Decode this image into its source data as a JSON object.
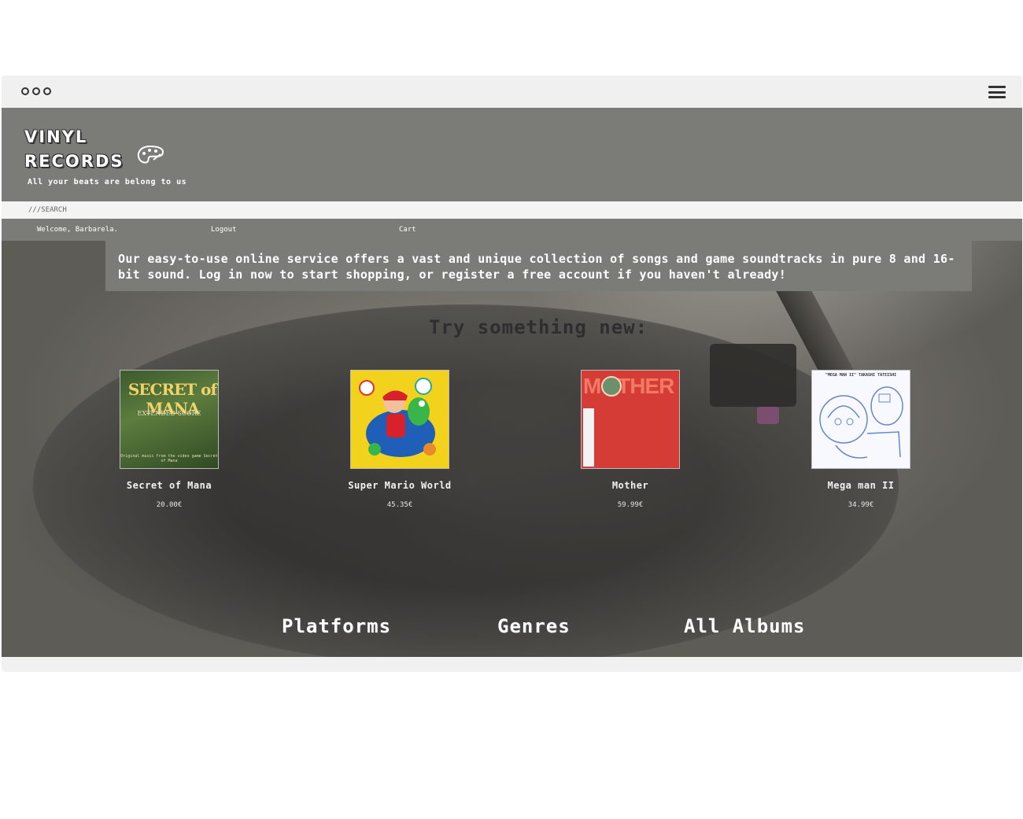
{
  "window": {
    "controls": [
      "o",
      "o",
      "o"
    ],
    "menu_icon": "hamburger-icon"
  },
  "header": {
    "logo_line1": "VINYL",
    "logo_line2": "RECORDS",
    "logo_icon": "palette-icon",
    "tagline": "All your beats are belong to us"
  },
  "search": {
    "placeholder": "///SEARCH"
  },
  "nav": {
    "welcome": "Welcome, Barbarela.",
    "logout": "Logout",
    "cart": "Cart"
  },
  "intro": "Our easy-to-use online service offers a vast and unique collection of songs and game soundtracks in pure 8 and 16-bit sound. Log in now to start shopping, or register a free account if you haven't already!",
  "featured": {
    "heading": "Try something new:",
    "albums": [
      {
        "title": "Secret of Mana",
        "price": "20.00€",
        "cover_title": "SECRET of MANA",
        "cover_subtitle": "EXTENDED SCORE",
        "cover_caption": "Original music from the video game Secret of Mana"
      },
      {
        "title": "Super Mario World",
        "price": "45.35€"
      },
      {
        "title": "Mother",
        "price": "59.99€",
        "cover_title": "MOTHER"
      },
      {
        "title": "Mega man II",
        "price": "34.99€",
        "cover_caption": "\"MEGA MAN II\" TAKASHI TATEISHI"
      }
    ]
  },
  "links": {
    "platforms": "Platforms",
    "genres": "Genres",
    "all_albums": "All Albums"
  },
  "colors": {
    "header_bg": "#7b7b77",
    "search_bg": "#f4f4f4",
    "heading": "#2e2e2e",
    "text": "#ffffff"
  }
}
